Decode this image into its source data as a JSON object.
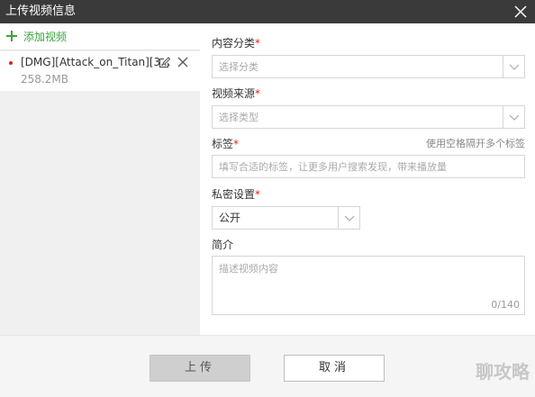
{
  "window": {
    "title": "上传视频信息",
    "close_icon": "close-icon"
  },
  "sidebar": {
    "add_video_label": "添加视频",
    "accent_color": "#3aa53a",
    "files": [
      {
        "name": "[DMG][Attack_on_Titan][3...",
        "size": "258.2MB"
      }
    ]
  },
  "form": {
    "category": {
      "label": "内容分类",
      "required": "*",
      "placeholder": "选择分类"
    },
    "source": {
      "label": "视频来源",
      "required": "*",
      "placeholder": "选择类型"
    },
    "tags": {
      "label": "标签",
      "required": "*",
      "hint": "使用空格隔开多个标签",
      "placeholder": "填写合适的标签，让更多用户搜索发现，带来播放量"
    },
    "privacy": {
      "label": "私密设置",
      "required": "*",
      "value": "公开"
    },
    "intro": {
      "label": "简介",
      "placeholder": "描述视频内容",
      "counter": "0/140"
    }
  },
  "footer": {
    "upload_label": "上传",
    "cancel_label": "取消",
    "watermark": "聊攻略"
  }
}
